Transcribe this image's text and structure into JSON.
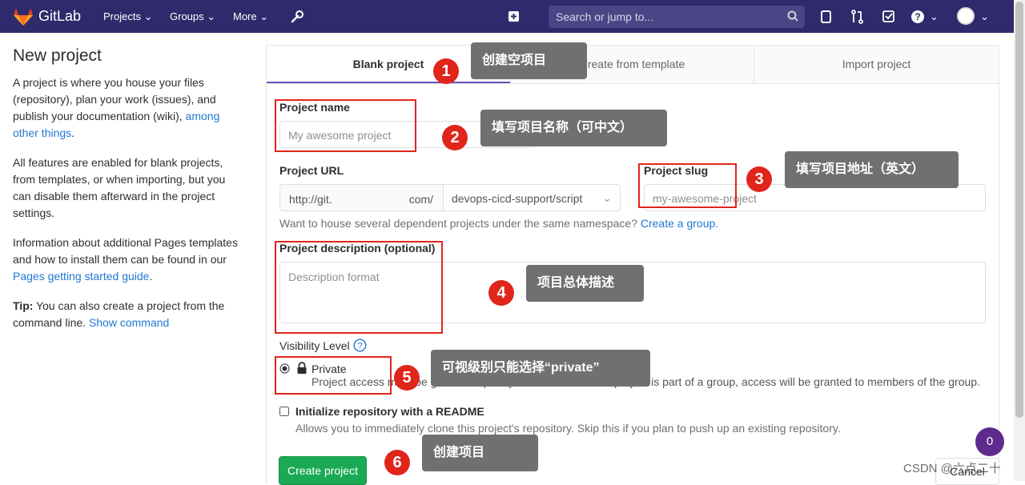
{
  "nav": {
    "brand": "GitLab",
    "projects": "Projects",
    "groups": "Groups",
    "more": "More",
    "search_placeholder": "Search or jump to...",
    "icons": [
      "wrench-icon",
      "plus-icon",
      "search-icon",
      "issues-icon",
      "merge-request-icon",
      "todo-icon",
      "help-icon",
      "avatar"
    ],
    "bar_color": "#2f2a6b"
  },
  "left": {
    "title": "New project",
    "p1_text": "A project is where you house your files (repository), plan your work (issues), and publish your documentation (wiki), ",
    "p1_link": "among other things",
    "p1_end": ".",
    "p2": "All features are enabled for blank projects, from templates, or when importing, but you can disable them afterward in the project settings.",
    "p3_text": "Information about additional Pages templates and how to install them can be found in our ",
    "p3_link": "Pages getting started guide",
    "p3_end": ".",
    "tip_label": "Tip:",
    "tip_text": " You can also create a project from the command line. ",
    "tip_link": "Show command"
  },
  "tabs": {
    "blank": "Blank project",
    "template": "Create from template",
    "import": "Import project"
  },
  "form": {
    "name_label": "Project name",
    "name_placeholder": "My awesome project",
    "url_label": "Project URL",
    "url_prefix": "http://git.",
    "url_prefix_end": "com/",
    "url_namespace": "devops-cicd-support/script",
    "slug_label": "Project slug",
    "slug_placeholder": "my-awesome-project",
    "ns_note": "Want to house several dependent projects under the same namespace? ",
    "ns_link": "Create a group.",
    "desc_label": "Project description (optional)",
    "desc_placeholder": "Description format",
    "visibility_label": "Visibility Level",
    "private_label": "Private",
    "private_help": "Project access must be granted explicitly to each user. If this project is part of a group, access will be granted to members of the group.",
    "readme_label": "Initialize repository with a README",
    "readme_help": "Allows you to immediately clone this project's repository. Skip this if you plan to push up an existing repository.",
    "create_button": "Create project",
    "cancel_button": "Cancel"
  },
  "annotations": {
    "c1": "创建空项目",
    "c2": "填写项目名称（可中文）",
    "c3": "填写项目地址（英文）",
    "c4": "项目总体描述",
    "c5": "可视级别只能选择“private”",
    "c6": "创建项目",
    "n1": "1",
    "n2": "2",
    "n3": "3",
    "n4": "4",
    "n5": "5",
    "n6": "6"
  },
  "badge_count": "0",
  "watermark": "CSDN @六点二十"
}
